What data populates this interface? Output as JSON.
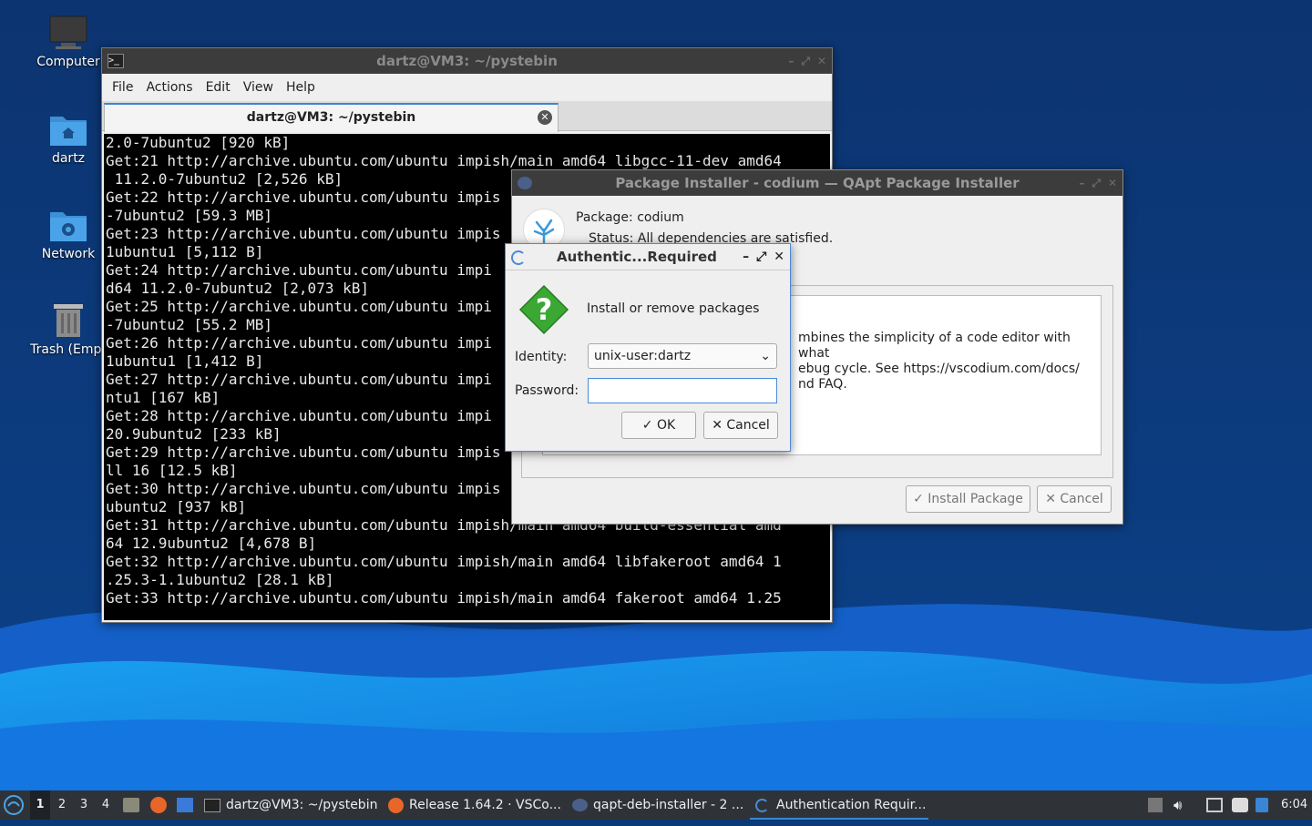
{
  "desktop": {
    "icons": [
      {
        "label": "Computer"
      },
      {
        "label": "dartz"
      },
      {
        "label": "Network"
      },
      {
        "label": "Trash (Empt"
      }
    ]
  },
  "terminal": {
    "title": "dartz@VM3: ~/pystebin",
    "menu": [
      "File",
      "Actions",
      "Edit",
      "View",
      "Help"
    ],
    "tab_label": "dartz@VM3: ~/pystebin",
    "lines": [
      "2.0-7ubuntu2 [920 kB]",
      "Get:21 http://archive.ubuntu.com/ubuntu impish/main amd64 libgcc-11-dev amd64",
      " 11.2.0-7ubuntu2 [2,526 kB]",
      "Get:22 http://archive.ubuntu.com/ubuntu impis",
      "-7ubuntu2 [59.3 MB]",
      "Get:23 http://archive.ubuntu.com/ubuntu impis",
      "1ubuntu1 [5,112 B]",
      "Get:24 http://archive.ubuntu.com/ubuntu impi",
      "d64 11.2.0-7ubuntu2 [2,073 kB]",
      "Get:25 http://archive.ubuntu.com/ubuntu impi",
      "-7ubuntu2 [55.2 MB]",
      "Get:26 http://archive.ubuntu.com/ubuntu impi",
      "1ubuntu1 [1,412 B]",
      "Get:27 http://archive.ubuntu.com/ubuntu impi",
      "ntu1 [167 kB]",
      "Get:28 http://archive.ubuntu.com/ubuntu impi",
      "20.9ubuntu2 [233 kB]",
      "Get:29 http://archive.ubuntu.com/ubuntu impis",
      "ll 16 [12.5 kB]",
      "Get:30 http://archive.ubuntu.com/ubuntu impis",
      "ubuntu2 [937 kB]",
      "Get:31 http://archive.ubuntu.com/ubuntu impish/main amd64 build-essential amd",
      "64 12.9ubuntu2 [4,678 B]",
      "Get:32 http://archive.ubuntu.com/ubuntu impish/main amd64 libfakeroot amd64 1",
      ".25.3-1.1ubuntu2 [28.1 kB]",
      "Get:33 http://archive.ubuntu.com/ubuntu impish/main amd64 fakeroot amd64 1.25"
    ]
  },
  "qapt": {
    "title": "Package Installer - codium — QApt Package Installer",
    "package_label": "Package:",
    "package_name": "codium",
    "status_label": "Status:",
    "status_text": "All dependencies are satisfied.",
    "description": [
      "mbines the simplicity of a code editor with what",
      "ebug cycle. See https://vscodium.com/docs/",
      "nd FAQ."
    ],
    "install_button": "Install Package",
    "cancel_button": "Cancel"
  },
  "auth": {
    "title": "Authentic...Required",
    "message": "Install or remove packages",
    "identity_label": "Identity:",
    "identity_value": "unix-user:dartz",
    "password_label": "Password:",
    "password_value": "",
    "ok_button": "OK",
    "cancel_button": "Cancel"
  },
  "taskbar": {
    "workspaces": [
      "1",
      "2",
      "3",
      "4"
    ],
    "active_workspace": "1",
    "tasks": [
      {
        "label": "dartz@VM3: ~/pystebin"
      },
      {
        "label": "Release 1.64.2 · VSCo..."
      },
      {
        "label": "qapt-deb-installer - 2 ..."
      },
      {
        "label": "Authentication Requir..."
      }
    ],
    "clock": "6:04"
  },
  "colors": {
    "accent": "#3a86d4",
    "desktop_dark": "#0b3a78",
    "wave_light": "#1a8fe8",
    "titlebar_dark": "#3c3c3c",
    "taskbar": "#2f3338"
  }
}
